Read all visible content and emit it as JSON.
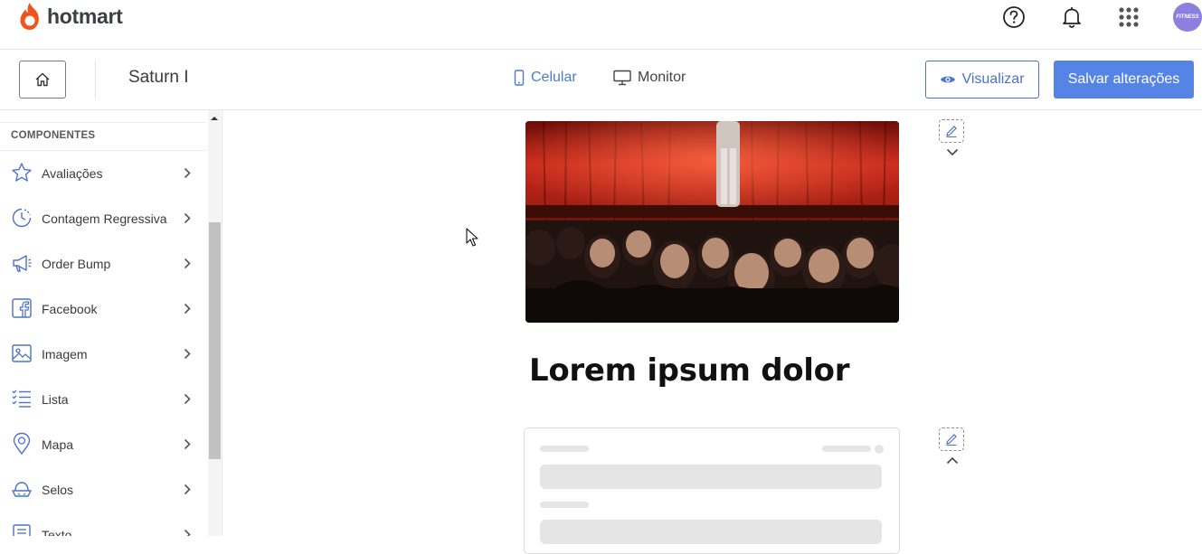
{
  "header": {
    "brand": "hotmart",
    "avatar_text": "FITNESS",
    "icons": [
      "help-icon",
      "bell-icon",
      "apps-grid-icon"
    ]
  },
  "toolbar": {
    "page_name": "Saturn I",
    "device_mobile": "Celular",
    "device_desktop": "Monitor",
    "preview_label": "Visualizar",
    "save_label": "Salvar alterações"
  },
  "sidebar": {
    "section_title": "COMPONENTES",
    "items": [
      {
        "label": "Avaliações",
        "icon": "star-icon"
      },
      {
        "label": "Contagem Regressiva",
        "icon": "clock-icon"
      },
      {
        "label": "Order Bump",
        "icon": "megaphone-icon"
      },
      {
        "label": "Facebook",
        "icon": "facebook-icon"
      },
      {
        "label": "Imagem",
        "icon": "image-icon"
      },
      {
        "label": "Lista",
        "icon": "list-icon"
      },
      {
        "label": "Mapa",
        "icon": "map-pin-icon"
      },
      {
        "label": "Selos",
        "icon": "seal-icon"
      },
      {
        "label": "Texto",
        "icon": "text-icon"
      }
    ]
  },
  "canvas": {
    "headline": "Lorem ipsum dolor"
  },
  "colors": {
    "accent": "#5584e6",
    "brand_orange": "#f0531c",
    "text": "#3a3a3a"
  }
}
